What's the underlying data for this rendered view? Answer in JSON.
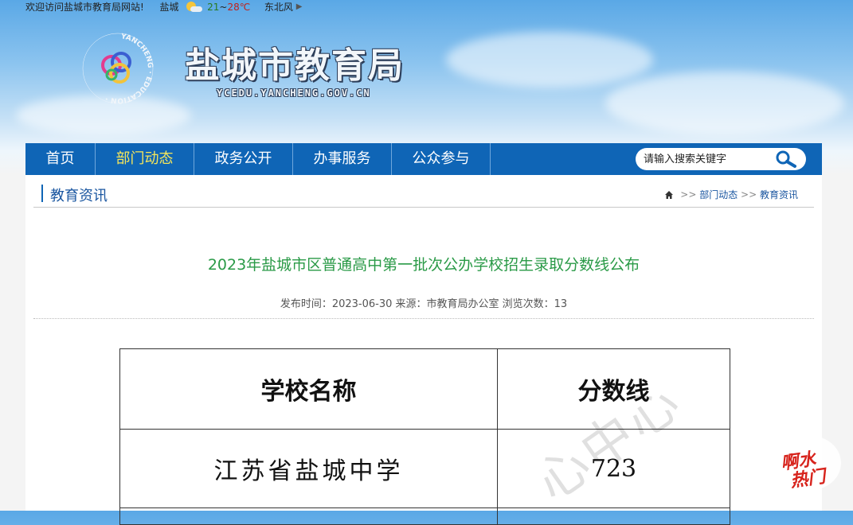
{
  "topbar": {
    "welcome": "欢迎访问盐城市教育局网站!",
    "city": "盐城",
    "weather_icon": "partly-cloudy-icon",
    "temp_low": "21",
    "temp_sep": "~",
    "temp_high": "28℃",
    "wind": "东北风",
    "more_icon": "triangle-right-icon"
  },
  "header": {
    "logo_ring_text": "CHINA YANCHENG EDUCATION",
    "title": "盐城市教育局",
    "domain": "YCEDU.YANCHENG.GOV.CN"
  },
  "nav": {
    "items": [
      {
        "label": "首页"
      },
      {
        "label": "部门动态",
        "active": true
      },
      {
        "label": "政务公开"
      },
      {
        "label": "办事服务"
      },
      {
        "label": "公众参与"
      }
    ],
    "search_placeholder": "请输入搜索关键字",
    "search_icon": "magnifier-icon"
  },
  "section": {
    "title": "教育资讯",
    "breadcrumb": {
      "home_icon": "home-icon",
      "sep": ">>",
      "items": [
        "部门动态",
        "教育资讯"
      ]
    }
  },
  "article": {
    "title": "2023年盐城市区普通高中第一批次公办学校招生录取分数线公布",
    "meta": "发布时间：2023-06-30 来源：市教育局办公室 浏览次数：13",
    "table": {
      "headers": [
        "学校名称",
        "分数线"
      ],
      "rows": [
        [
          "江苏省盐城中学",
          "723"
        ]
      ]
    }
  },
  "watermark": "心中心",
  "badge": {
    "line1": "啊水",
    "line2": "热门"
  },
  "colors": {
    "nav_bg": "#0f65b6",
    "nav_active": "#f6e65a",
    "title_green": "#2a9a47",
    "link_blue": "#1a56a0",
    "badge_red": "#d7231c"
  }
}
